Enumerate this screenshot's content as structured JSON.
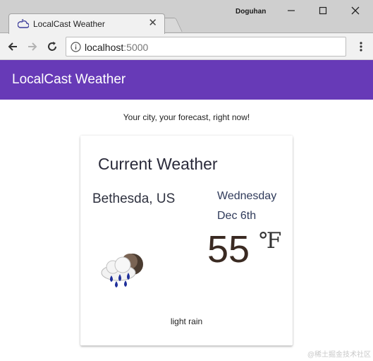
{
  "browser": {
    "tab_title": "LocalCast Weather",
    "window_user": "Doguhan",
    "url_host": "localhost",
    "url_port": ":5000"
  },
  "app": {
    "title": "LocalCast Weather",
    "tagline": "Your city, your forecast, right now!"
  },
  "weather": {
    "card_title": "Current Weather",
    "city": "Bethesda, US",
    "day": "Wednesday",
    "date": "Dec 6th",
    "temperature": "55",
    "unit": "℉",
    "description": "light rain",
    "icon": "rain-cloud-icon"
  },
  "watermark": "@稀土掘金技术社区",
  "colors": {
    "primary": "#673ab7",
    "toolbar_text": "#ffffff"
  }
}
